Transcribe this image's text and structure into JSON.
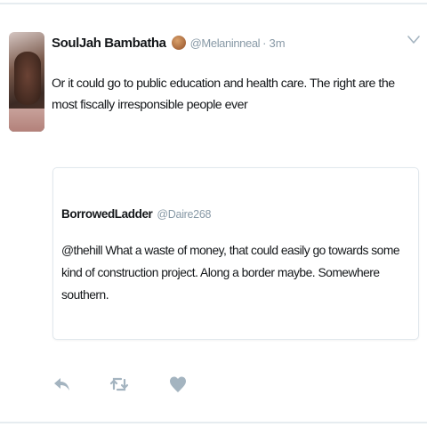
{
  "tweet": {
    "display_name": "SoulJah Bambatha",
    "handle": "@Melaninneal",
    "separator": "·",
    "time": "3m",
    "text": "Or it could go to public education and health care. The right are the most fiscally irresponsible people ever",
    "badge_icon": "emoji-face-icon"
  },
  "quoted_tweet": {
    "display_name": "BorrowedLadder",
    "handle": "@Daire268",
    "text": "@thehill What a waste of money, that could easily go towards some kind of construction project. Along a border maybe. Somewhere southern."
  },
  "actions": [
    {
      "name": "reply",
      "icon": "reply-icon"
    },
    {
      "name": "retweet",
      "icon": "retweet-icon"
    },
    {
      "name": "like",
      "icon": "heart-icon"
    }
  ],
  "menu_icon": "chevron-down-icon",
  "colors": {
    "text": "#14171a",
    "secondary": "#8899a6",
    "border": "#e1e8ed",
    "action_icon": "#a4b4c0"
  }
}
